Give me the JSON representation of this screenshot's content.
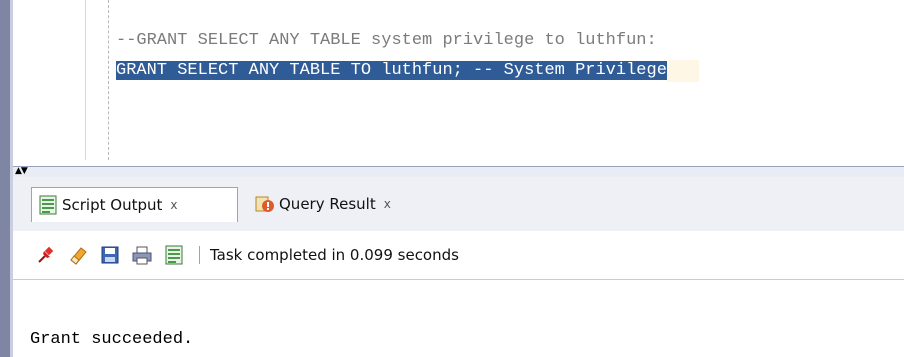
{
  "editor": {
    "line1": "--GRANT SELECT ANY TABLE system privilege to luthfun:",
    "line2": "GRANT SELECT ANY TABLE TO luthfun; -- System Privilege"
  },
  "tabs": [
    {
      "label": "Script Output",
      "close": "x",
      "icon": "script-output-icon"
    },
    {
      "label": "Query Result",
      "close": "x",
      "icon": "query-result-icon"
    }
  ],
  "toolbar": {
    "icons": [
      "pin-icon",
      "eraser-icon",
      "save-icon",
      "print-icon",
      "document-icon"
    ],
    "status": "Task completed in 0.099 seconds"
  },
  "output": {
    "text": "Grant succeeded."
  },
  "colors": {
    "selection": "#2f5c96",
    "comment": "#7b7b7b",
    "panel": "#eef0f6"
  }
}
